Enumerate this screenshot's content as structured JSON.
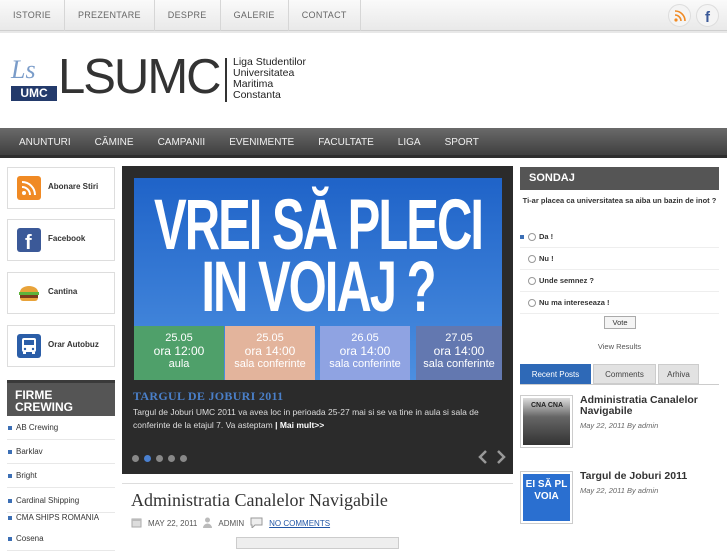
{
  "topnav": {
    "links": [
      "ISTORIE",
      "PREZENTARE",
      "DESPRE",
      "GALERIE",
      "CONTACT"
    ]
  },
  "header": {
    "logo_text": "LSUMC",
    "logo_small": "UMC",
    "logo_mark": "Ls",
    "subtitle": [
      "Liga Studentilor",
      "Universitatea",
      "Maritima",
      "Constanta"
    ]
  },
  "mainnav": {
    "items": [
      "ANUNTURI",
      "CĂMINE",
      "CAMPANII",
      "EVENIMENTE",
      "FACULTATE",
      "LIGA",
      "SPORT"
    ]
  },
  "left": {
    "boxes": [
      {
        "label": "Abonare Stiri",
        "icon": "rss-icon"
      },
      {
        "label": "Facebook",
        "icon": "facebook-icon"
      },
      {
        "label": "Cantina",
        "icon": "burger-icon"
      },
      {
        "label": "Orar Autobuz",
        "icon": "bus-icon"
      }
    ],
    "firme_title": "FIRME CREWING",
    "crewing": [
      "AB Crewing",
      "Barklav",
      "Bright",
      "Cardinal Shipping",
      "CMA SHIPS ROMANIA",
      "Cosena"
    ]
  },
  "slider": {
    "line1": "VREI SĂ PLECI",
    "line2": "IN VOIAJ ?",
    "cells": [
      {
        "date": "25.05",
        "time": "ora 12:00",
        "place": "aula",
        "color": "#4fa06a"
      },
      {
        "date": "25.05",
        "time": "ora 14:00",
        "place": "sala conferinte",
        "color": "#e3b49c"
      },
      {
        "date": "26.05",
        "time": "ora 14:00",
        "place": "sala conferinte",
        "color": "#8fa3e2"
      },
      {
        "date": "27.05",
        "time": "ora 14:00",
        "place": "sala conferinte",
        "color": "#6378b0"
      }
    ],
    "title": "TARGUL DE JOBURI 2011",
    "desc": "Targul de Joburi UMC 2011 va avea loc in perioada 25-27 mai si se va tine in aula si sala de conferinte de la etajul 7. Va asteptam",
    "more": "| Mai mult>>"
  },
  "post": {
    "title": "Administratia Canalelor Navigabile",
    "date": "MAY 22, 2011",
    "author": "ADMIN",
    "comments": "NO COMMENTS"
  },
  "poll": {
    "title": "SONDAJ",
    "question": "Ti-ar placea ca universitatea sa aiba un bazin de inot ?",
    "options": [
      "Da !",
      "Nu !",
      "Unde semnez ?",
      "Nu ma intereseaza !"
    ],
    "vote": "Vote",
    "view_results": "View Results"
  },
  "tabs": [
    "Recent Posts",
    "Comments",
    "Arhiva"
  ],
  "recent": [
    {
      "title": "Administratia Canalelor Navigabile",
      "date": "May 22, 2011 By admin"
    },
    {
      "title": "Targul de Joburi 2011",
      "date": "May 22, 2011 By admin"
    }
  ],
  "colors": {
    "accent": "#2e69b7",
    "nav_dark": "#4a4a4a",
    "slide_blue": "#2a6fd0"
  }
}
